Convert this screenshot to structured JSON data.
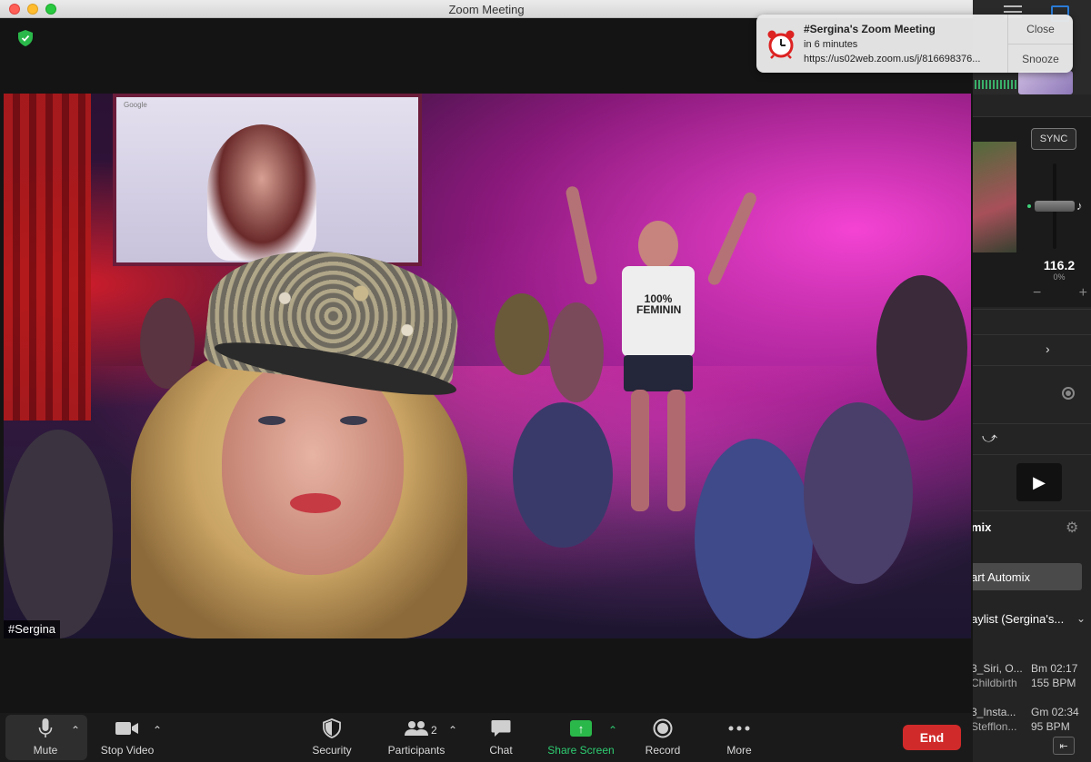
{
  "window": {
    "title": "Zoom Meeting"
  },
  "participant": {
    "name": "#Sergina"
  },
  "stage_art": {
    "screen_text": "Google",
    "shirt_text": "100% FEMININ"
  },
  "toolbar": {
    "mute": "Mute",
    "stop_video": "Stop Video",
    "security": "Security",
    "participants": "Participants",
    "participants_count": "2",
    "chat": "Chat",
    "share_screen": "Share Screen",
    "record": "Record",
    "more": "More",
    "end": "End"
  },
  "notification": {
    "title": "#Sergina's Zoom Meeting",
    "subtitle": "in 6 minutes",
    "url": "https://us02web.zoom.us/j/816698376...",
    "close": "Close",
    "snooze": "Snooze"
  },
  "dj_app": {
    "sync": "SYNC",
    "bpm": "116.2",
    "pitch": "0%",
    "mix_label": "mix",
    "automix_button": "art Automix",
    "playlist": "aylist (Sergina's...",
    "tracks": [
      {
        "title": "3_Siri, O...",
        "artist": "Childbirth",
        "key": "Bm 02:17",
        "bpm": "155 BPM"
      },
      {
        "title": "3_Insta...",
        "artist": "Stefflon...",
        "key": "Gm 02:34",
        "bpm": "95 BPM"
      }
    ]
  },
  "colors": {
    "end": "#d12a2a",
    "share": "#2ab84a",
    "share_text": "#2ecc71",
    "shield": "#2ab84a"
  }
}
